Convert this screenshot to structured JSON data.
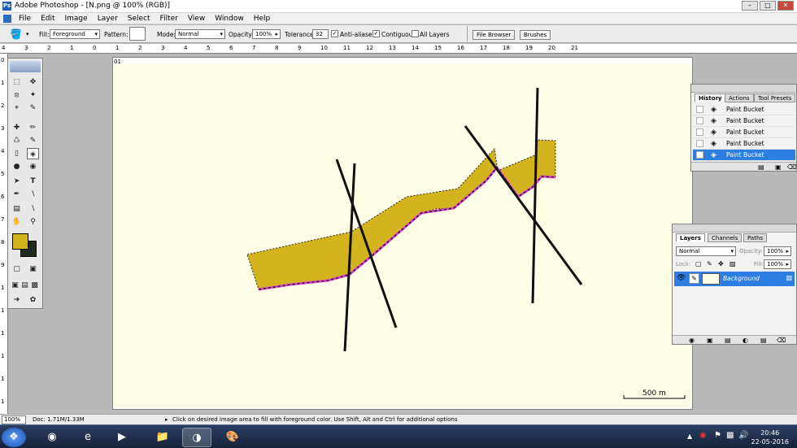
{
  "window": {
    "title": "Adobe Photoshop - [N.png @ 100% (RGB)]",
    "min": "–",
    "max": "□",
    "close": "✕"
  },
  "menu": [
    "File",
    "Edit",
    "Image",
    "Layer",
    "Select",
    "Filter",
    "View",
    "Window",
    "Help"
  ],
  "options": {
    "fill_label": "Fill:",
    "fill_value": "Foreground",
    "pattern_label": "Pattern:",
    "mode_label": "Mode:",
    "mode_value": "Normal",
    "opacity_label": "Opacity:",
    "opacity_value": "100%",
    "tolerance_label": "Tolerance:",
    "tolerance_value": "32",
    "anti_aliased": "Anti-aliased",
    "contiguous": "Contiguous",
    "all_layers": "All Layers"
  },
  "palette_well": {
    "tabs": [
      "File Browser",
      "Brushes"
    ]
  },
  "ruler": {
    "h_numbers": [
      "4",
      "3",
      "2",
      "1",
      "0",
      "1",
      "2",
      "3",
      "4",
      "5",
      "6",
      "7",
      "8",
      "9",
      "10",
      "11",
      "12",
      "13",
      "14",
      "15",
      "16",
      "17",
      "18",
      "19",
      "20",
      "21"
    ],
    "v_numbers": [
      "0",
      "1",
      "2",
      "3",
      "4",
      "5",
      "6",
      "7",
      "8",
      "9",
      "1",
      "1",
      "1",
      "1",
      "1",
      "1"
    ]
  },
  "document": {
    "indicator": "01"
  },
  "scale_bar": {
    "label": "500 m"
  },
  "history": {
    "tabs": [
      "History",
      "Actions",
      "Tool Presets"
    ],
    "items": [
      "Paint Bucket",
      "Paint Bucket",
      "Paint Bucket",
      "Paint Bucket",
      "Paint Bucket"
    ],
    "selected_index": 4
  },
  "layers": {
    "tabs": [
      "Layers",
      "Channels",
      "Paths"
    ],
    "blend_mode": "Normal",
    "opacity_label": "Opacity:",
    "opacity_value": "100%",
    "lock_label": "Lock:",
    "fill_label": "Fill:",
    "fill_value": "100%",
    "layer_name": "Background"
  },
  "status": {
    "zoom": "100%",
    "doc": "Doc: 1.71M/1.33M",
    "hint": "Click on desired image area to fill with foreground color.  Use Shift, Alt and Ctrl for additional options"
  },
  "taskbar": {
    "time": "20:46",
    "date": "22-05-2016"
  },
  "colors": {
    "foreground": "#d4b41e",
    "background": "#1f2a1f",
    "fill": "#d4b41e",
    "edge": "#e040d0",
    "selection": "#2c7ee0"
  }
}
